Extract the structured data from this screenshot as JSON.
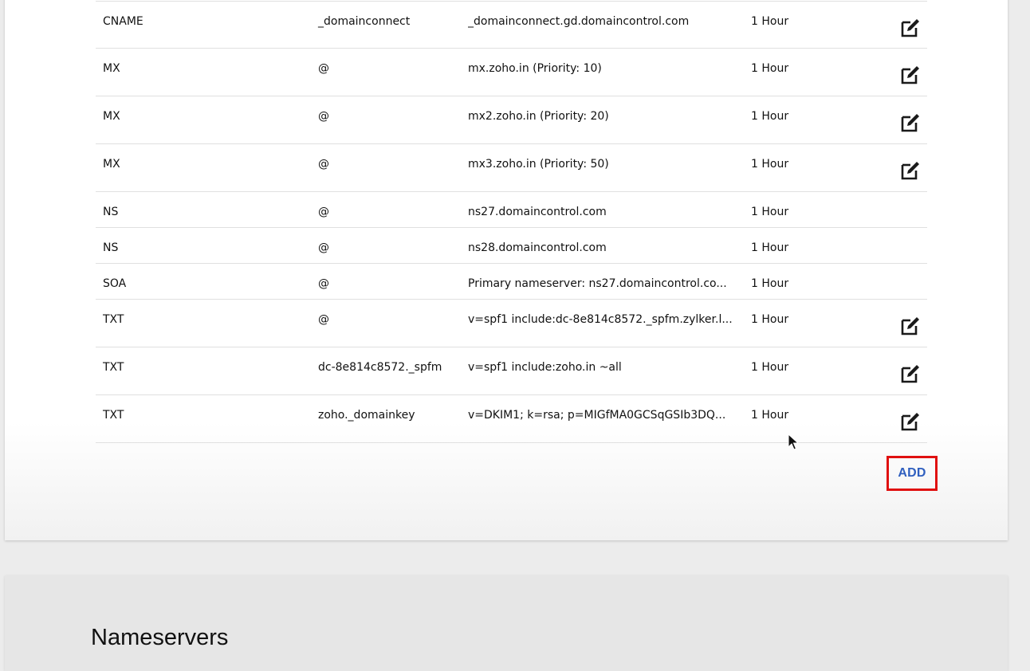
{
  "dns_records": [
    {
      "type": "CNAME",
      "name": "_domainconnect",
      "value": "_domainconnect.gd.domaincontrol.com",
      "ttl": "1 Hour",
      "editable": true
    },
    {
      "type": "MX",
      "name": "@",
      "value": "mx.zoho.in (Priority: 10)",
      "ttl": "1 Hour",
      "editable": true
    },
    {
      "type": "MX",
      "name": "@",
      "value": "mx2.zoho.in (Priority: 20)",
      "ttl": "1 Hour",
      "editable": true
    },
    {
      "type": "MX",
      "name": "@",
      "value": "mx3.zoho.in (Priority: 50)",
      "ttl": "1 Hour",
      "editable": true
    },
    {
      "type": "NS",
      "name": "@",
      "value": "ns27.domaincontrol.com",
      "ttl": "1 Hour",
      "editable": false
    },
    {
      "type": "NS",
      "name": "@",
      "value": "ns28.domaincontrol.com",
      "ttl": "1 Hour",
      "editable": false
    },
    {
      "type": "SOA",
      "name": "@",
      "value": "Primary nameserver: ns27.domaincontrol.co...",
      "ttl": "1 Hour",
      "editable": false
    },
    {
      "type": "TXT",
      "name": "@",
      "value": "v=spf1 include:dc-8e814c8572._spfm.zylker.l...",
      "ttl": "1 Hour",
      "editable": true
    },
    {
      "type": "TXT",
      "name": "dc-8e814c8572._spfm",
      "value": "v=spf1 include:zoho.in ~all",
      "ttl": "1 Hour",
      "editable": true
    },
    {
      "type": "TXT",
      "name": "zoho._domainkey",
      "value": "v=DKIM1; k=rsa; p=MIGfMA0GCSqGSIb3DQ...",
      "ttl": "1 Hour",
      "editable": true
    }
  ],
  "actions": {
    "add_label": "ADD",
    "edit_icon": "edit-pencil-square-icon"
  },
  "nameservers": {
    "title": "Nameservers"
  },
  "colors": {
    "add_text": "#2f5fbf",
    "highlight_border": "#e01010",
    "row_divider": "#e0e0e0"
  }
}
